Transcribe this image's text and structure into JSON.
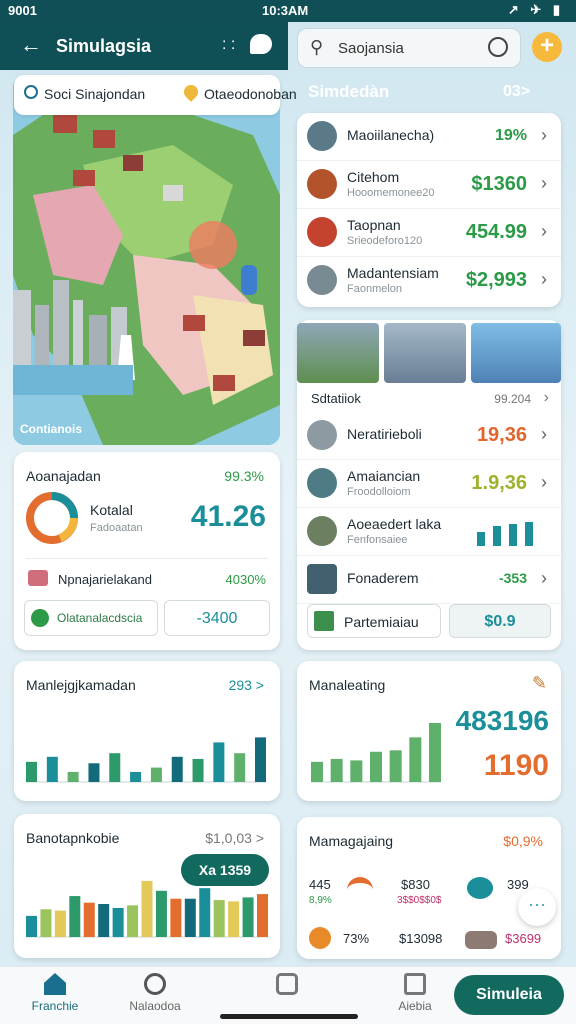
{
  "status_bar": {
    "left": "9001",
    "time": "10:3AM",
    "right": "↗ ✈ ▮"
  },
  "header": {
    "back": "←",
    "title": "Simulagsia",
    "dots": ": :"
  },
  "search": {
    "text": "Saojansia",
    "icon": "search-icon"
  },
  "plus": "+",
  "map": {
    "pill_left": "Soci Sinajondan",
    "pill_right": "Otaeodonoban",
    "footer": "Contianois"
  },
  "right_heading": {
    "title": "Simdedàn",
    "count": "03>"
  },
  "list": [
    {
      "name": "Maoiilanecha)",
      "sub": "",
      "value": "19%",
      "color": "#2c9a46",
      "avatar": "#5a7a8a"
    },
    {
      "name": "Citehom",
      "sub": "Hooomemonee20",
      "value": "$1360",
      "color": "#2c9a46",
      "avatar": "#b3532c"
    },
    {
      "name": "Taopnan",
      "sub": "Srieodeforo120",
      "value": "454.99",
      "color": "#2c9a46",
      "avatar": "#c4432f"
    },
    {
      "name": "Madantensiam",
      "sub": "Faonmelon",
      "value": "$2,993",
      "color": "#2c9a46",
      "avatar": "#7a8a92"
    }
  ],
  "photos": {
    "title": "Sdtatiiok",
    "value": "99.204",
    "colors": [
      "#5e8f4f",
      "#6a7f95",
      "#4e82b5"
    ]
  },
  "photo_rows": [
    {
      "name": "Neratirieboli",
      "sub": "",
      "value": "19,36",
      "color": "#e0662d",
      "avatar": "#8d9aa1"
    },
    {
      "name": "Amaiancian",
      "sub": "Froodolloiom",
      "value": "1.9,36",
      "color": "#9bb32c",
      "avatar": "#4f7b84"
    },
    {
      "name": "Aoeaedert laka",
      "sub": "Fenfonsaiee",
      "value": "",
      "color": "#1a8e99",
      "avatar": "#6c8061"
    },
    {
      "name": "Fonaderem",
      "sub": "",
      "value": "-353",
      "color": "#2c9a46",
      "avatar": "#41616f"
    }
  ],
  "partner": {
    "label": "Partemiaiau",
    "value": "$0.9"
  },
  "stats": {
    "title": "Aoanajadan",
    "pct": "99.3%",
    "name": "Kotalal",
    "sub": "Fadoaatan",
    "big": "41.26",
    "row2_name": "Npnajarielakand",
    "row2_val": "4030%",
    "chip_left": "Olatanalacdscia",
    "chip_right": "-3400"
  },
  "card1": {
    "title": "Manlejgjkamadan",
    "value": "293 >"
  },
  "card2": {
    "title": "Manaleating",
    "v1": "483196",
    "v2": "1190"
  },
  "card3": {
    "title": "Banotapnkobie",
    "value": "$1,0,03 >",
    "tag": "Xa 1359"
  },
  "card4": {
    "title": "Mamagajaing",
    "value": "$0,9%",
    "r1": [
      "445",
      "8,9%",
      "$830",
      "3$$0$$0$",
      "399"
    ],
    "r2": [
      "73%",
      "$13098",
      "$3699"
    ]
  },
  "nav": {
    "home": "Franchie",
    "search": "Nalaodoa",
    "center": "",
    "right": "Aiebia",
    "cta": "Simuleia"
  },
  "charts": {
    "chart1": [
      0.28,
      0.35,
      0.14,
      0.26,
      0.4,
      0.14,
      0.2,
      0.35,
      0.32,
      0.55,
      0.4,
      0.62
    ],
    "chart2": [
      0.28,
      0.32,
      0.3,
      0.42,
      0.44,
      0.62,
      0.82
    ],
    "chart3": [
      0.32,
      0.42,
      0.4,
      0.62,
      0.52,
      0.5,
      0.44,
      0.48,
      0.85,
      0.7,
      0.58,
      0.58,
      0.74,
      0.56,
      0.54,
      0.6,
      0.65
    ]
  }
}
